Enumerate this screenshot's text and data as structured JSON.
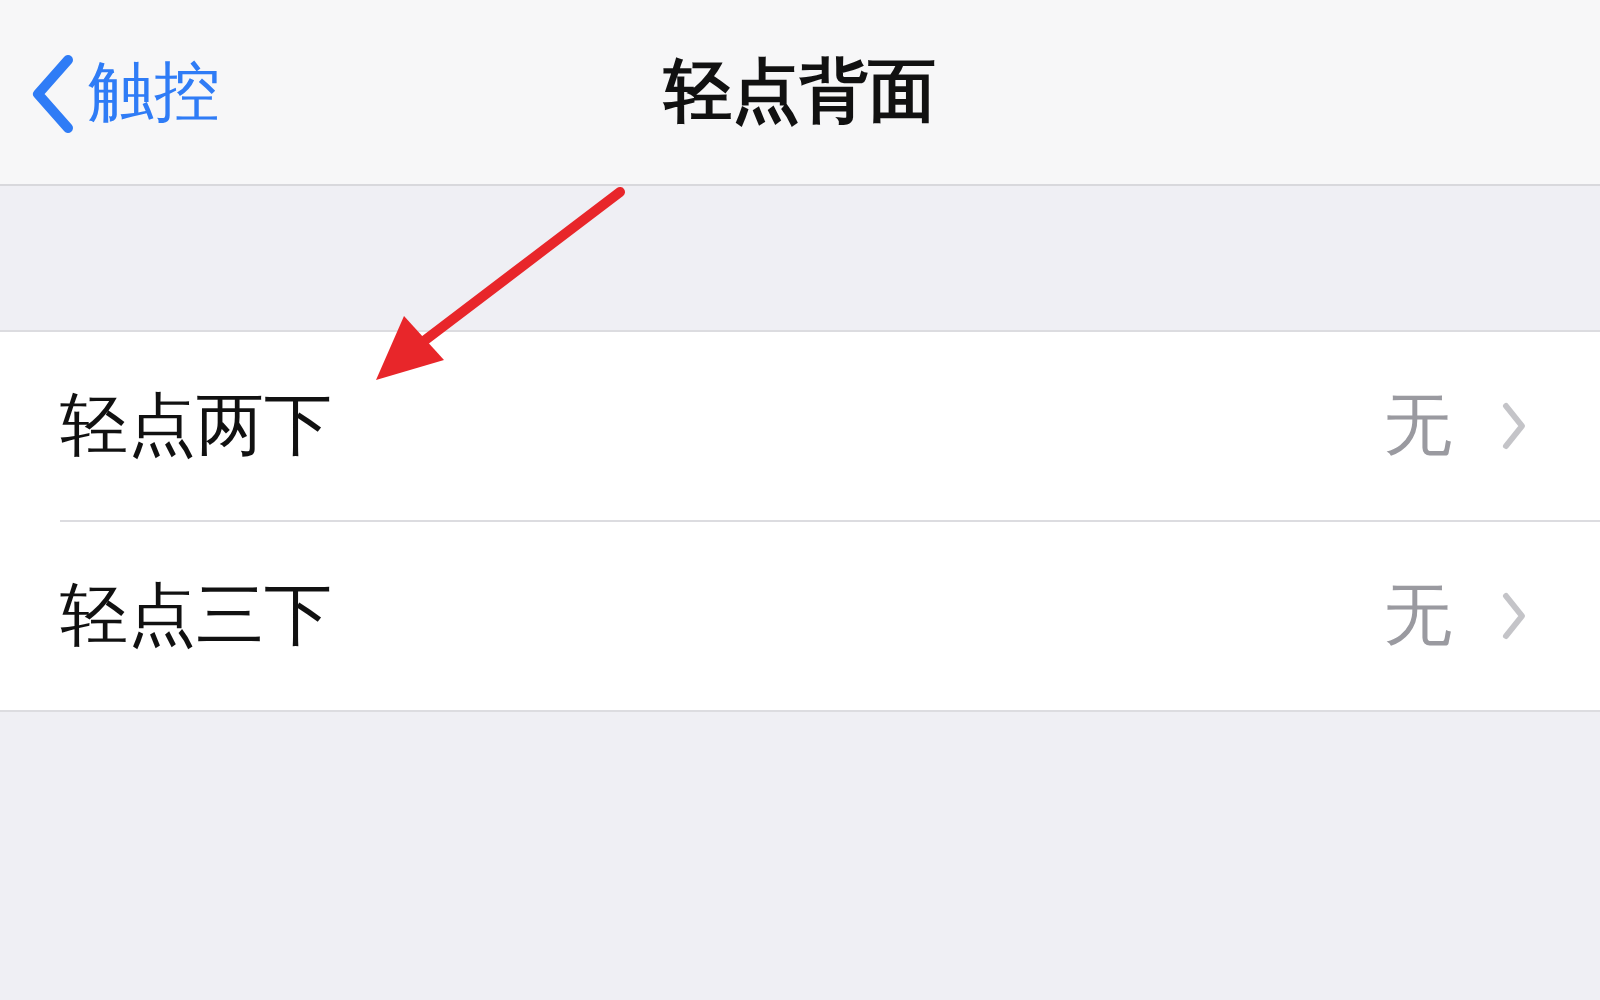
{
  "nav": {
    "back": "触控",
    "title": "轻点背面"
  },
  "rows": [
    {
      "label": "轻点两下",
      "value": "无"
    },
    {
      "label": "轻点三下",
      "value": "无"
    }
  ]
}
